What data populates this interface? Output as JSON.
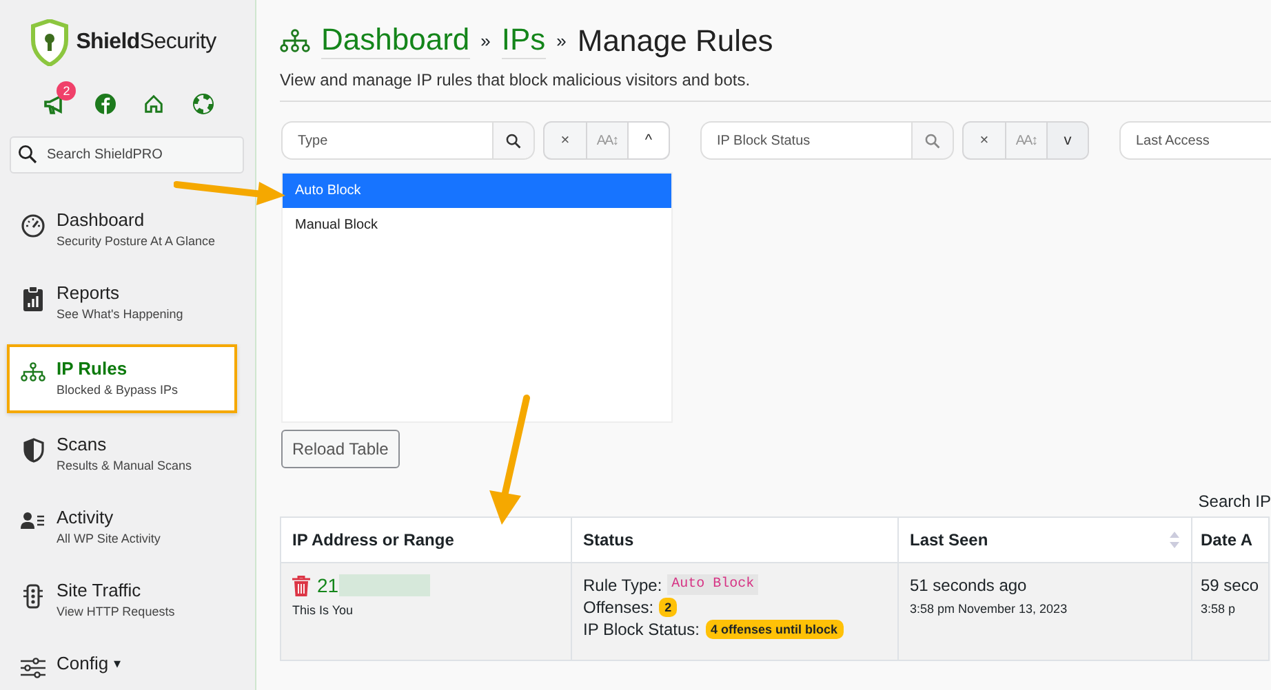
{
  "sidebar": {
    "brand_bold": "Shield",
    "brand_rest": "Security",
    "notification_count": "2",
    "search": {
      "placeholder": "Search ShieldPRO"
    },
    "nav": [
      {
        "title": "Dashboard",
        "subtitle": "Security Posture At A Glance",
        "selected": false
      },
      {
        "title": "Reports",
        "subtitle": "See What's Happening",
        "selected": false
      },
      {
        "title": "IP Rules",
        "subtitle": "Blocked & Bypass IPs",
        "selected": true
      },
      {
        "title": "Scans",
        "subtitle": "Results & Manual Scans",
        "selected": false
      },
      {
        "title": "Activity",
        "subtitle": "All WP Site Activity",
        "selected": false
      },
      {
        "title": "Site Traffic",
        "subtitle": "View HTTP Requests",
        "selected": false
      },
      {
        "title": "Config",
        "caret": "▾",
        "selected": false
      }
    ]
  },
  "header": {
    "breadcrumb": [
      "Dashboard",
      "IPs"
    ],
    "separator": "»",
    "title": "Manage Rules",
    "description": "View and manage IP rules that block malicious visitors and bots."
  },
  "filters": [
    {
      "placeholder": "Type",
      "clear": "×",
      "case": "AA↕",
      "toggle": "^",
      "expanded": true,
      "options": [
        {
          "label": "Auto Block",
          "selected": true
        },
        {
          "label": "Manual Block",
          "selected": false
        }
      ]
    },
    {
      "placeholder": "IP Block Status",
      "clear": "×",
      "case": "AA↕",
      "toggle": "v",
      "expanded": false
    },
    {
      "placeholder": "Last Access"
    }
  ],
  "reload_button": "Reload Table",
  "search_label": "Search IP",
  "table": {
    "columns": [
      {
        "label": "IP Address or Range"
      },
      {
        "label": "Status"
      },
      {
        "label": "Last Seen",
        "sortable": true
      },
      {
        "label": "Date A"
      }
    ],
    "rows": [
      {
        "ip": "21",
        "ip_note": "This Is You",
        "rule_type_label": "Rule Type:",
        "rule_type": "Auto Block",
        "offenses_label": "Offenses:",
        "offenses": "2",
        "block_status_label": "IP Block Status:",
        "block_status": "4 offenses until block",
        "last_seen": "51 seconds ago",
        "last_seen_date": "3:58 pm November 13, 2023",
        "date_added": "59 seco",
        "date_added_date": "3:58 p"
      }
    ]
  }
}
